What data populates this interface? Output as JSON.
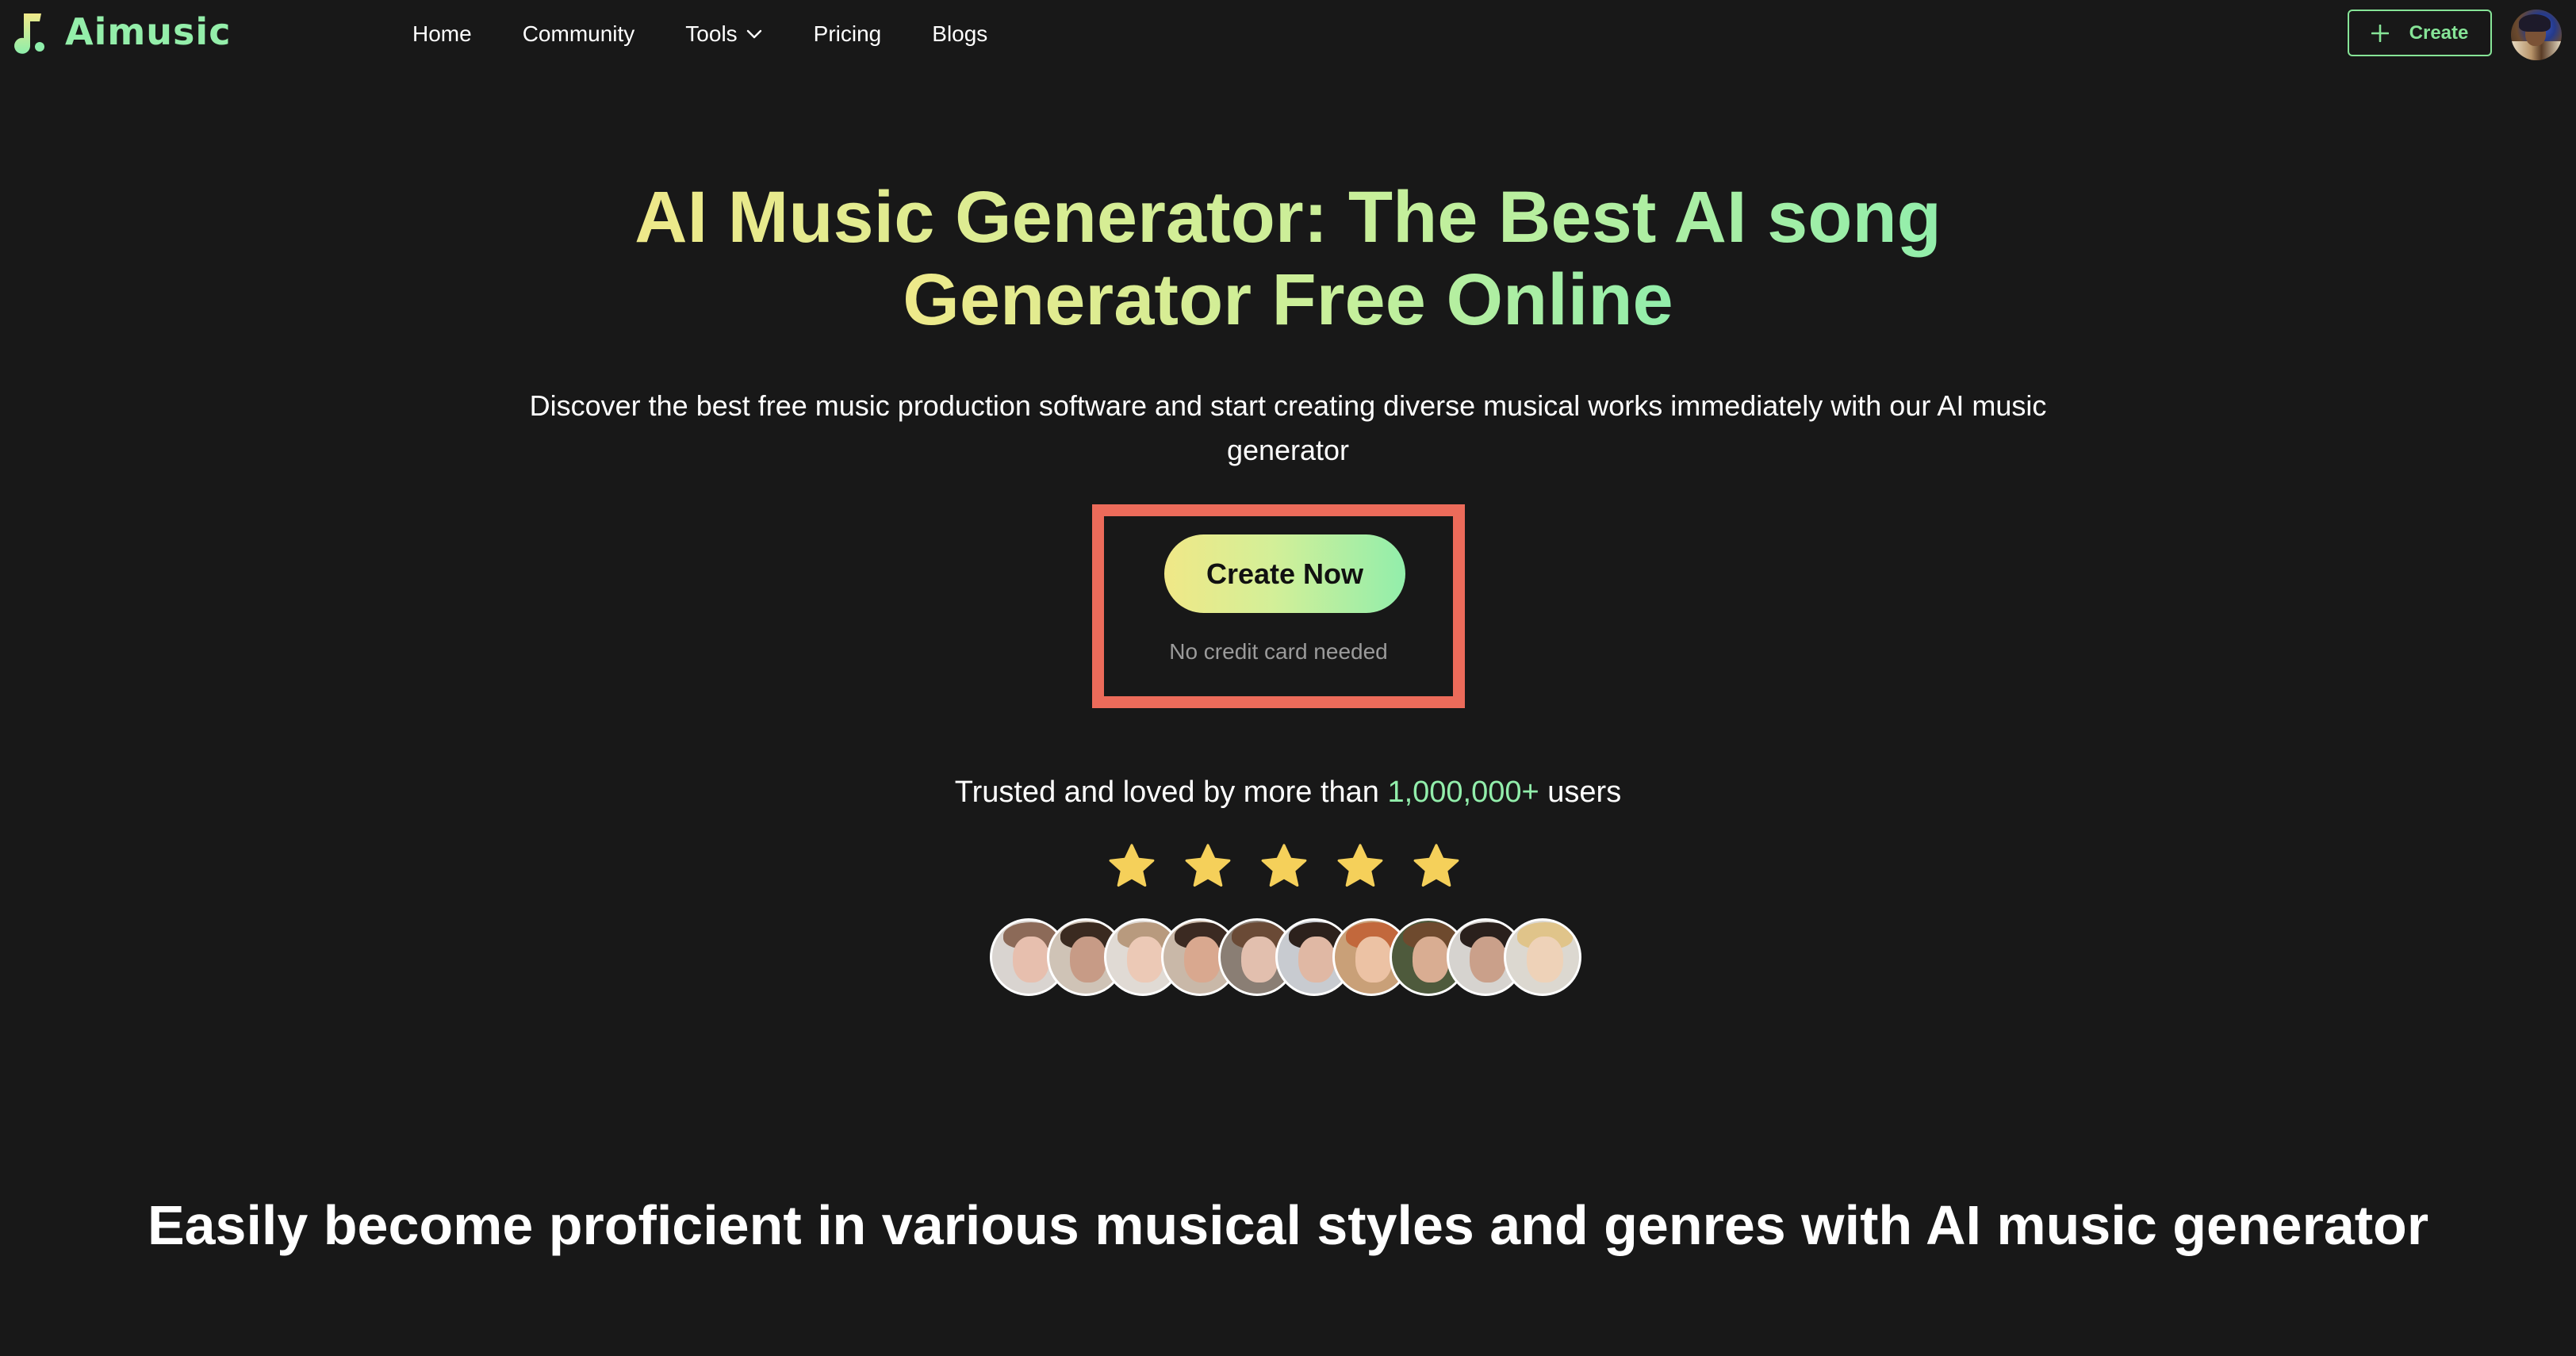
{
  "header": {
    "logo_text": "Aimusic",
    "logo_icon": "music-note-icon",
    "nav": [
      {
        "label": "Home"
      },
      {
        "label": "Community"
      },
      {
        "label": "Tools",
        "has_dropdown": true
      },
      {
        "label": "Pricing"
      },
      {
        "label": "Blogs"
      }
    ],
    "create_button": {
      "label": "Create",
      "icon": "plus-icon"
    },
    "user_avatar": "user-avatar"
  },
  "hero": {
    "title_line1": "AI Music Generator: The Best AI song",
    "title_line2": "Generator Free Online",
    "subtitle": "Discover the best free music production software and start creating diverse musical works immediately with our AI music generator",
    "cta_label": "Create Now",
    "cta_note": "No credit card needed",
    "trusted_prefix": "Trusted and loved by more than ",
    "trusted_count": "1,000,000+",
    "trusted_suffix": " users",
    "rating": {
      "value": 5,
      "max": 5
    },
    "user_faces_count": 10
  },
  "colors": {
    "background": "#181818",
    "accent_green": "#92eeab",
    "accent_yellow": "#eee98a",
    "star": "#f5d05a",
    "highlight_box": "#ec6b5a",
    "muted_text": "#9b9b9b"
  },
  "section": {
    "title": "Easily become proficient in various musical styles and genres with AI music generator"
  }
}
